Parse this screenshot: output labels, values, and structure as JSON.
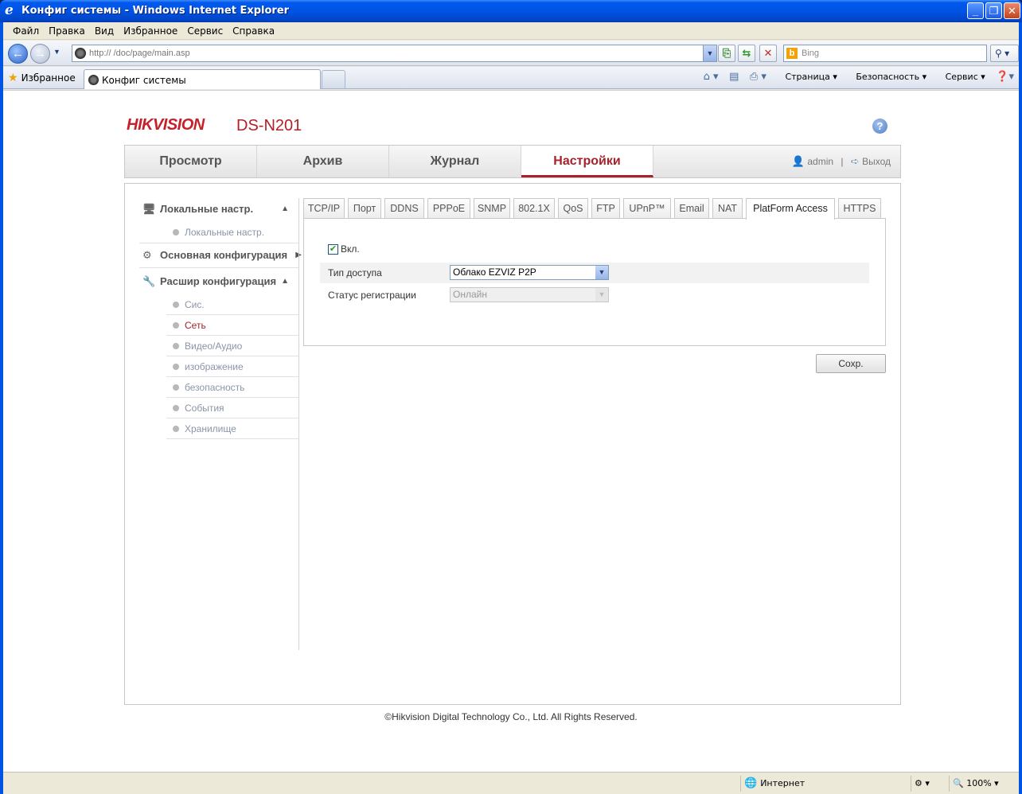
{
  "window": {
    "title": "Конфиг системы - Windows Internet Explorer"
  },
  "menu": [
    "Файл",
    "Правка",
    "Вид",
    "Избранное",
    "Сервис",
    "Справка"
  ],
  "nav": {
    "url": "http://                    /doc/page/main.asp",
    "search_placeholder": "Bing"
  },
  "favbar": {
    "favorites": "Избранное",
    "tab_title": "Конфиг системы",
    "commands": [
      "Страница",
      "Безопасность",
      "Сервис"
    ]
  },
  "header": {
    "brand": "HIKVISION",
    "model": "DS-N201"
  },
  "topnav": {
    "items": [
      "Просмотр",
      "Архив",
      "Журнал",
      "Настройки"
    ],
    "user": "admin",
    "separator": "|",
    "logout": "Выход"
  },
  "sidebar": {
    "groups": [
      {
        "label": "Локальные настр."
      },
      {
        "label": "Основная конфигурация"
      },
      {
        "label": "Расшир конфигурация"
      }
    ],
    "local_sub": "Локальные настр.",
    "adv_items": [
      "Сис.",
      "Сеть",
      "Видео/Аудио",
      "изображение",
      "безопасность",
      "События",
      "Хранилище"
    ]
  },
  "subtabs": [
    "TCP/IP",
    "Порт",
    "DDNS",
    "PPPoE",
    "SNMP",
    "802.1X",
    "QoS",
    "FTP",
    "UPnP™",
    "Email",
    "NAT",
    "PlatForm Access",
    "HTTPS"
  ],
  "form": {
    "enable_label": "Вкл.",
    "enable_checked": true,
    "access_type_label": "Тип доступа",
    "access_type_value": "Облако EZVIZ P2P",
    "reg_status_label": "Статус регистрации",
    "reg_status_value": "Онлайн"
  },
  "save_label": "Сохр.",
  "footer": "©Hikvision Digital Technology Co., Ltd. All Rights Reserved.",
  "status": {
    "zone": "Интернет",
    "zoom": "100%"
  }
}
